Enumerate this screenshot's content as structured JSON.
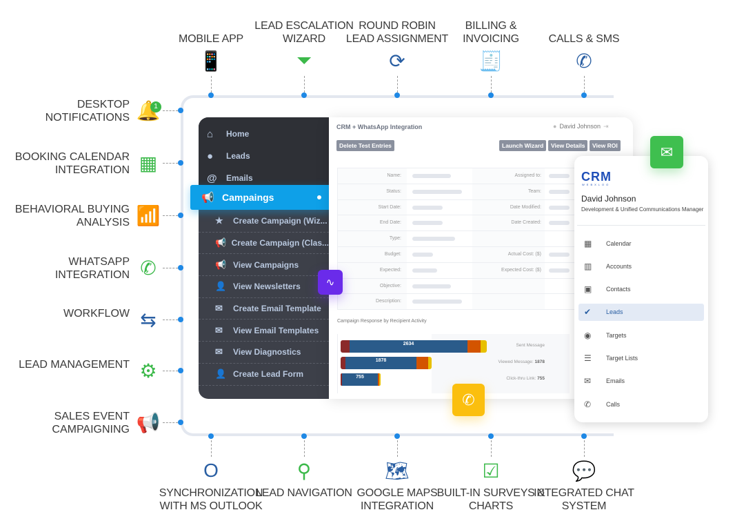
{
  "top_features": [
    {
      "label": "MOBILE APP",
      "icon": "mobile-app-icon"
    },
    {
      "label": "LEAD ESCALATION WIZARD",
      "icon": "funnel-icon"
    },
    {
      "label": "ROUND ROBIN LEAD ASSIGNMENT",
      "icon": "round-robin-icon"
    },
    {
      "label": "BILLING & INVOICING",
      "icon": "invoice-icon"
    },
    {
      "label": "CALLS & SMS",
      "icon": "phone-sms-icon"
    }
  ],
  "left_features": [
    {
      "label": "DESKTOP NOTIFICATIONS",
      "icon": "bell-icon",
      "badge": "1"
    },
    {
      "label": "BOOKING CALENDAR INTEGRATION",
      "icon": "calendar-icon"
    },
    {
      "label": "BEHAVIORAL BUYING ANALYSIS",
      "icon": "bar-chart-icon"
    },
    {
      "label": "WHATSAPP INTEGRATION",
      "icon": "whatsapp-icon"
    },
    {
      "label": "WORKFLOW",
      "icon": "workflow-icon"
    },
    {
      "label": "LEAD MANAGEMENT",
      "icon": "gears-icon"
    },
    {
      "label": "SALES EVENT CAMPAIGNING",
      "icon": "megaphone-icon"
    }
  ],
  "bottom_features": [
    {
      "label": "SYNCHRONIZATION WITH MS OUTLOOK",
      "icon": "outlook-icon"
    },
    {
      "label": "LEAD NAVIGATION",
      "icon": "map-pin-icon"
    },
    {
      "label": "GOOGLE MAPS INTEGRATION",
      "icon": "google-maps-icon"
    },
    {
      "label": "BUILT-IN SURVEYS & CHARTS",
      "icon": "survey-clipboard-icon"
    },
    {
      "label": "INTEGRATED CHAT SYSTEM",
      "icon": "chat-icon"
    }
  ],
  "sidebar": {
    "items": [
      {
        "label": "Home",
        "icon": "home-icon"
      },
      {
        "label": "Leads",
        "icon": "user-icon"
      },
      {
        "label": "Emails",
        "icon": "at-icon"
      }
    ],
    "active": {
      "label": "Campaings",
      "icon": "megaphone-icon"
    },
    "subitems": [
      {
        "label": "Create Campaign (Wiz..."
      },
      {
        "label": "Create Campaign (Clas..."
      },
      {
        "label": "View Campaigns"
      },
      {
        "label": "View Newsletters"
      },
      {
        "label": "Create Email Template"
      },
      {
        "label": "View Email Templates"
      },
      {
        "label": "View Diagnostics"
      },
      {
        "label": "Create Lead Form"
      }
    ]
  },
  "main": {
    "title": "CRM + WhatsApp Integration",
    "user": "David Johnson",
    "buttons": {
      "delete": "Delete Test Entries",
      "launch": "Launch Wizard",
      "details": "View Details",
      "roi": "View ROI"
    },
    "fields_left": [
      "Name:",
      "Status:",
      "Start Date:",
      "End Date:",
      "Type:",
      "Budget:",
      "Expected:",
      "Objective:",
      "Description:"
    ],
    "fields_right": [
      "Assigned to:",
      "Team:",
      "Date Modified:",
      "Date Created:",
      "",
      "Actual Cost: ($)",
      "Expected Cost: ($)",
      "",
      ""
    ],
    "chart_title": "Campaign Response by Recipient Activity",
    "bars": [
      {
        "value": "2634",
        "label": "Sent Message"
      },
      {
        "value": "1878",
        "label": "Viewed Message:",
        "label_value": "1878"
      },
      {
        "value": "755",
        "label": "Click-thru Link:",
        "label_value": "755"
      }
    ]
  },
  "mobile": {
    "logo": "CRM",
    "logo_sub": "WEBXLOO",
    "name": "David Johnson",
    "role": "Development & Unified Communications Manager",
    "items": [
      {
        "label": "Calendar",
        "icon": "calendar-icon"
      },
      {
        "label": "Accounts",
        "icon": "building-icon"
      },
      {
        "label": "Contacts",
        "icon": "contact-card-icon"
      },
      {
        "label": "Leads",
        "icon": "lead-check-icon",
        "active": true
      },
      {
        "label": "Targets",
        "icon": "target-icon"
      },
      {
        "label": "Target Lists",
        "icon": "list-icon"
      },
      {
        "label": "Emails",
        "icon": "envelope-icon"
      },
      {
        "label": "Calls",
        "icon": "phone-icon"
      }
    ]
  },
  "colors": {
    "blue": "#2a5fa3",
    "green": "#3cb94a",
    "accent": "#0ea0e8",
    "purple": "#6a2bea",
    "yellow": "#fbbf0e"
  }
}
